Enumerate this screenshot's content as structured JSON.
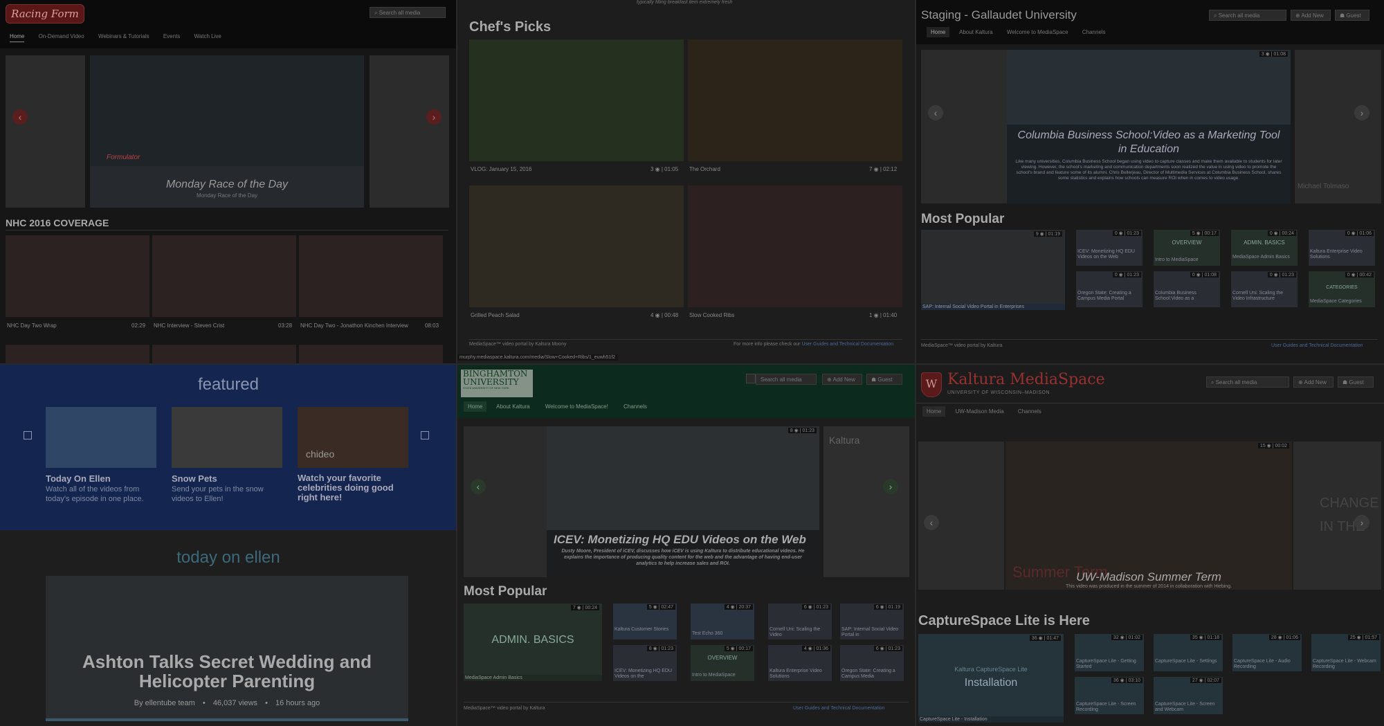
{
  "racing": {
    "logo": "Racing Form",
    "search_placeholder": "Search all media",
    "nav": [
      "Home",
      "On-Demand Video",
      "Webinars & Tutorials",
      "Events",
      "Watch Live"
    ],
    "hero_title": "Monday Race of the Day",
    "hero_sub": "Monday Race of the Day",
    "hero_overlay": "Formulator",
    "section": "NHC 2016 COVERAGE",
    "videos": [
      {
        "title": "NHC Day Two Wrap",
        "duration": "02:29"
      },
      {
        "title": "NHC Interview - Steven Crist",
        "duration": "03:28"
      },
      {
        "title": "NHC Day Two - Jonathon Kinchen Interview",
        "duration": "08:03"
      }
    ]
  },
  "chefs": {
    "top_text": "typically filling breakfast item extremely fresh",
    "section": "Chef's Picks",
    "items": [
      {
        "title": "VLOG: January 15, 2016",
        "meta": "3 ◉ | 01:05"
      },
      {
        "title": "The Orchard",
        "meta": "7 ◉ | 02:12"
      },
      {
        "title": "Grilled Peach Salad",
        "meta": "4 ◉ | 00:48"
      },
      {
        "title": "Slow Cooked Ribs",
        "meta": "1 ◉ | 01:40"
      }
    ],
    "footer_left": "MediaSpace™ video portal by Kaltura Moony",
    "footer_right_prefix": "For more info please check our",
    "footer_right_link": "User Guides and Technical Documentation",
    "url": "murphy.mediaspace.kaltura.com/media/Slow+Cooked+Ribs/1_euwh51f2"
  },
  "gallaudet": {
    "title": "Staging - Gallaudet University",
    "search_placeholder": "Search all media",
    "add_new": "Add New",
    "guest": "Guest",
    "nav": [
      "Home",
      "About Kaltura",
      "Welcome to MediaSpace",
      "Channels"
    ],
    "hero_title": "Columbia Business School:Video as a Marketing Tool in Education",
    "hero_desc": "Like many universities, Columbia Business School began using video to capture classes and make them available to students for later viewing. However, the school's marketing and communication departments soon realized the value in using video to promote the school's brand and feature some of its alumni. Chris Bellerjeau, Director of Multimedia Services at Columbia Business School, shares some statistics and explains how schools can measure ROI when in comes to video usage.",
    "hero_meta": "3 ◉ | 01:08",
    "side_label": "Michael Tolmaso",
    "section": "Most Popular",
    "main_item": {
      "title": "SAP: Internal Social Video Portal in Enterprises",
      "meta": "9 ◉ | 01:19"
    },
    "items": [
      {
        "title": "ICEV: Monetizing HQ EDU Videos on the Web",
        "meta": "0 ◉ | 01:23"
      },
      {
        "title": "Intro to MediaSpace",
        "meta": "5 ◉ | 00:17",
        "overlay": "OVERVIEW"
      },
      {
        "title": "MediaSpace Admin Basics",
        "meta": "0 ◉ | 00:24",
        "overlay": "ADMIN. BASICS"
      },
      {
        "title": "Kaltura Enterprise Video Solutions",
        "meta": "0 ◉ | 01:06"
      },
      {
        "title": "Oregon State: Creating a Campus Media Portal",
        "meta": "0 ◉ | 01:23"
      },
      {
        "title": "Columbia Business School:Video as a",
        "meta": "0 ◉ | 01:08"
      },
      {
        "title": "Cornell Uni: Scaling the Video Infrastructure",
        "meta": "0 ◉ | 01:23"
      },
      {
        "title": "MediaSpace Categories",
        "meta": "0 ◉ | 00:42",
        "overlay": "CATEGORIES"
      }
    ],
    "footer_left": "MediaSpace™ video portal by Kaltura",
    "footer_right": "User Guides and Technical Documentation"
  },
  "ellen": {
    "featured": "featured",
    "items": [
      {
        "title": "Today On Ellen",
        "desc": "Watch all of the videos from today's episode in one place."
      },
      {
        "title": "Snow Pets",
        "desc": "Send your pets in the snow videos to Ellen!"
      },
      {
        "title": "Watch your favorite celebrities doing good right here!",
        "desc": "",
        "overlay": "chideo"
      }
    ],
    "today": "today on ellen",
    "hero_title": "Ashton Talks Secret Wedding and Helicopter Parenting",
    "hero_by": "By ellentube team",
    "hero_views": "46,037 views",
    "hero_time": "16 hours ago"
  },
  "binghamton": {
    "logo": "BINGHAMTON",
    "logo2": "UNIVERSITY",
    "logo_sub": "STATE UNIVERSITY OF NEW YORK",
    "search_placeholder": "Search all media",
    "add_new": "Add New",
    "guest": "Guest",
    "nav": [
      "Home",
      "About Kaltura",
      "Welcome to MediaSpace!",
      "Channels"
    ],
    "hero_title": "ICEV: Monetizing HQ EDU Videos on the Web",
    "hero_desc": "Dusty Moore, President of iCEV, discusses how iCEV is using Kaltura to distribute educational videos. He explains the importance of producing quality content for the web and the advantage of having end-user analytics to help increase sales and ROI.",
    "hero_meta": "8 ◉ | 01:23",
    "side_logo": "Kaltura",
    "section": "Most Popular",
    "main_item": {
      "title": "MediaSpace Admin Basics",
      "meta": "7 ◉ | 00:24",
      "overlay": "ADMIN. BASICS"
    },
    "items": [
      {
        "title": "Kaltura Customer Stories",
        "meta": "5 ◉ | 02:47"
      },
      {
        "title": "Test Echo 360",
        "meta": "4 ◉ | 20:37"
      },
      {
        "title": "Cornell Uni: Scaling the Video",
        "meta": "6 ◉ | 01:23"
      },
      {
        "title": "SAP: Internal Social Video Portal in",
        "meta": "6 ◉ | 01:19"
      },
      {
        "title": "ICEV: Monetizing HQ EDU Videos on the",
        "meta": "8 ◉ | 01:23"
      },
      {
        "title": "Intro to MediaSpace",
        "meta": "5 ◉ | 00:17",
        "overlay": "OVERVIEW"
      },
      {
        "title": "Kaltura Enterprise Video Solutions",
        "meta": "4 ◉ | 01:36"
      },
      {
        "title": "Oregon State: Creating a Campus Media",
        "meta": "6 ◉ | 01:23"
      }
    ],
    "footer_left": "MediaSpace™ video portal by Kaltura",
    "footer_right": "User Guides and Technical Documentation"
  },
  "wisconsin": {
    "title": "Kaltura MediaSpace",
    "subtitle": "UNIVERSITY OF WISCONSIN–MADISON",
    "search_placeholder": "Search all media",
    "add_new": "Add New",
    "guest": "Guest",
    "nav": [
      "Home",
      "UW-Madison Media",
      "Channels"
    ],
    "hero_title": "UW-Madison Summer Term",
    "hero_desc": "This video was produced in the summer of 2014 in collaboration with Hiebing.",
    "hero_overlay": "Summer Term",
    "hero_meta": "15 ◉ | 00:02",
    "side_text": "CHANGE IN THE",
    "section": "CaptureSpace Lite is Here",
    "main_item": {
      "title": "CaptureSpace Lite - Installation",
      "meta": "36 ◉ | 01:47",
      "overlay": "Installation",
      "overlay_top": "Kaltura CaptureSpace Lite"
    },
    "items": [
      {
        "title": "CaptureSpace Lite - Getting Started",
        "meta": "32 ◉ | 01:02"
      },
      {
        "title": "CaptureSpace Lite - Settings",
        "meta": "35 ◉ | 01:18"
      },
      {
        "title": "CaptureSpace Lite - Audio Recording",
        "meta": "28 ◉ | 01:06"
      },
      {
        "title": "CaptureSpace Lite - Webcam Recording",
        "meta": "25 ◉ | 01:57"
      },
      {
        "title": "CaptureSpace Lite - Screen Recording",
        "meta": "36 ◉ | 03:10"
      },
      {
        "title": "CaptureSpace Lite - Screen and Webcam",
        "meta": "27 ◉ | 02:07"
      }
    ]
  },
  "colors": {
    "racing_red": "#7a1f1f",
    "ellen_blue": "#14264f",
    "binghamton_green": "#0c2a1e",
    "link_blue": "#3a5a8a"
  }
}
